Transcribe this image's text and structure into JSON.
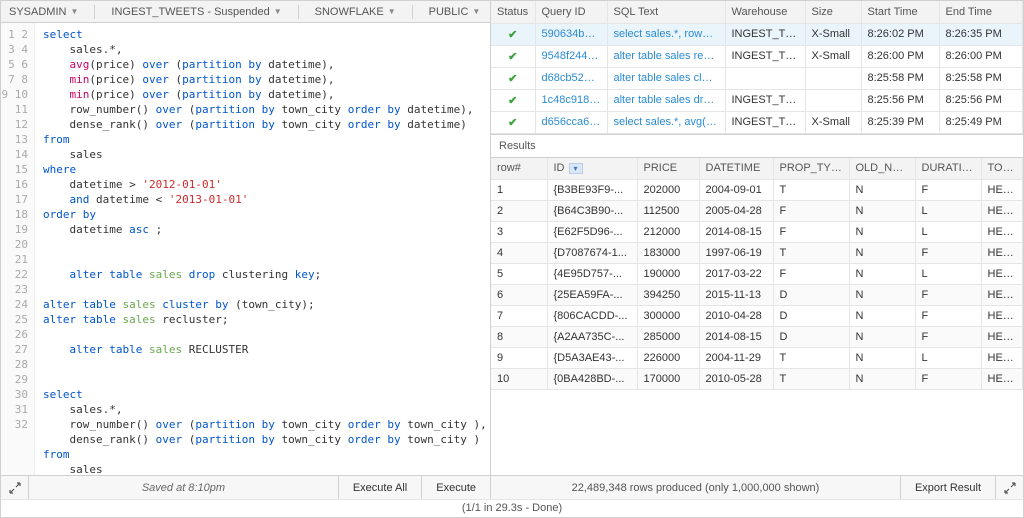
{
  "breadcrumbs": {
    "role": "SYSADMIN",
    "warehouse": "INGEST_TWEETS - Suspended",
    "database": "SNOWFLAKE",
    "schema": "PUBLIC"
  },
  "editor": {
    "lines": 32
  },
  "footer": {
    "saved": "Saved at 8:10pm",
    "execute_all": "Execute All",
    "execute": "Execute",
    "rows_info": "22,489,348 rows produced (only 1,000,000 shown)",
    "export": "Export Result",
    "status_line": "(1/1 in 29.3s - Done)"
  },
  "history": {
    "headers": [
      "Status",
      "Query ID",
      "SQL Text",
      "Warehouse",
      "Size",
      "Start Time",
      "End Time"
    ],
    "rows": [
      {
        "status": "ok",
        "id": "590634be-...",
        "sql": "select sales.*, row_nu...",
        "wh": "INGEST_TW...",
        "size": "X-Small",
        "start": "8:26:02 PM",
        "end": "8:26:35 PM",
        "sel": true
      },
      {
        "status": "ok",
        "id": "9548f244-e...",
        "sql": "alter table sales reclus...",
        "wh": "INGEST_TW...",
        "size": "X-Small",
        "start": "8:26:00 PM",
        "end": "8:26:00 PM"
      },
      {
        "status": "ok",
        "id": "d68cb52d-f...",
        "sql": "alter table sales cluste...",
        "wh": "",
        "size": "",
        "start": "8:25:58 PM",
        "end": "8:25:58 PM"
      },
      {
        "status": "ok",
        "id": "1c48c918-...",
        "sql": "alter table sales drop c...",
        "wh": "INGEST_TW...",
        "size": "",
        "start": "8:25:56 PM",
        "end": "8:25:56 PM"
      },
      {
        "status": "ok",
        "id": "d656cca6-...",
        "sql": "select sales.*, avg(pric...",
        "wh": "INGEST_TW...",
        "size": "X-Small",
        "start": "8:25:39 PM",
        "end": "8:25:49 PM"
      }
    ]
  },
  "results": {
    "title": "Results",
    "headers": [
      "row#",
      "ID",
      "PRICE",
      "DATETIME",
      "PROP_TYPE",
      "OLD_NEW",
      "DURATION",
      "TOWN"
    ],
    "sorted_col": "ID",
    "rows": [
      {
        "n": "1",
        "id": "{B3BE93F9-...",
        "price": "202000",
        "dt": "2004-09-01",
        "pt": "T",
        "on": "N",
        "dur": "F",
        "town": "HENL"
      },
      {
        "n": "2",
        "id": "{B64C3B90-...",
        "price": "112500",
        "dt": "2005-04-28",
        "pt": "F",
        "on": "N",
        "dur": "L",
        "town": "HENL"
      },
      {
        "n": "3",
        "id": "{E62F5D96-...",
        "price": "212000",
        "dt": "2014-08-15",
        "pt": "F",
        "on": "N",
        "dur": "L",
        "town": "HENL"
      },
      {
        "n": "4",
        "id": "{D7087674-1...",
        "price": "183000",
        "dt": "1997-06-19",
        "pt": "T",
        "on": "N",
        "dur": "F",
        "town": "HENL"
      },
      {
        "n": "5",
        "id": "{4E95D757-...",
        "price": "190000",
        "dt": "2017-03-22",
        "pt": "F",
        "on": "N",
        "dur": "L",
        "town": "HENL"
      },
      {
        "n": "6",
        "id": "{25EA59FA-...",
        "price": "394250",
        "dt": "2015-11-13",
        "pt": "D",
        "on": "N",
        "dur": "F",
        "town": "HENL"
      },
      {
        "n": "7",
        "id": "{806CACDD-...",
        "price": "300000",
        "dt": "2010-04-28",
        "pt": "D",
        "on": "N",
        "dur": "F",
        "town": "HENL"
      },
      {
        "n": "8",
        "id": "{A2AA735C-...",
        "price": "285000",
        "dt": "2014-08-15",
        "pt": "D",
        "on": "N",
        "dur": "F",
        "town": "HENL"
      },
      {
        "n": "9",
        "id": "{D5A3AE43-...",
        "price": "226000",
        "dt": "2004-11-29",
        "pt": "T",
        "on": "N",
        "dur": "L",
        "town": "HENL"
      },
      {
        "n": "10",
        "id": "{0BA428BD-...",
        "price": "170000",
        "dt": "2010-05-28",
        "pt": "T",
        "on": "N",
        "dur": "F",
        "town": "HENL"
      }
    ]
  }
}
